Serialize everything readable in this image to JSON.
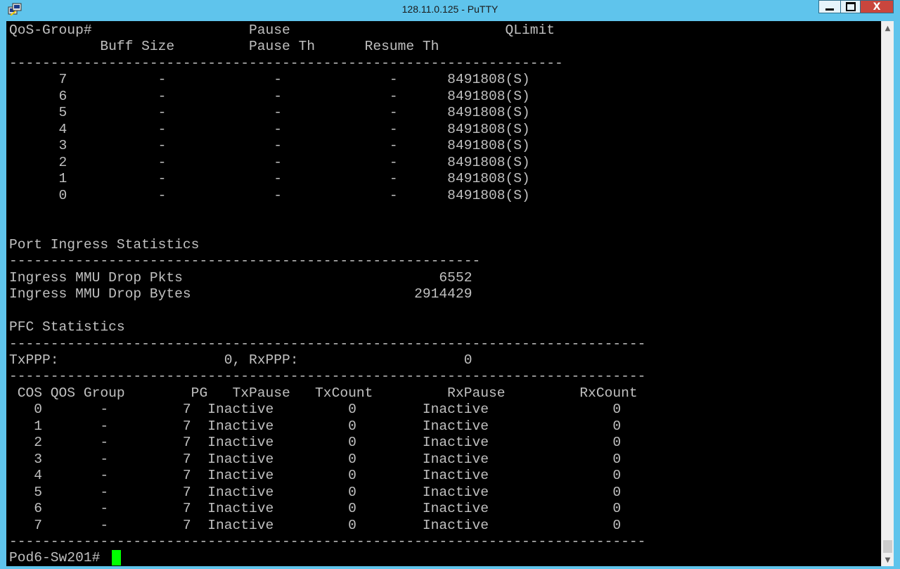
{
  "window": {
    "title": "128.11.0.125 - PuTTY",
    "icon": "putty-icon",
    "minimize_icon": "minimize-icon",
    "maximize_icon": "maximize-icon",
    "close_label": "X"
  },
  "terminal": {
    "lines": [
      "QoS-Group#                   Pause                          QLimit",
      "           Buff Size         Pause Th      Resume Th",
      "-------------------------------------------------------------------",
      "      7           -             -             -      8491808(S)",
      "      6           -             -             -      8491808(S)",
      "      5           -             -             -      8491808(S)",
      "      4           -             -             -      8491808(S)",
      "      3           -             -             -      8491808(S)",
      "      2           -             -             -      8491808(S)",
      "      1           -             -             -      8491808(S)",
      "      0           -             -             -      8491808(S)",
      "",
      "",
      "Port Ingress Statistics",
      "---------------------------------------------------------",
      "Ingress MMU Drop Pkts                               6552",
      "Ingress MMU Drop Bytes                           2914429",
      "",
      "PFC Statistics",
      "-----------------------------------------------------------------------------",
      "TxPPP:                    0, RxPPP:                    0",
      "-----------------------------------------------------------------------------",
      " COS QOS Group        PG   TxPause   TxCount         RxPause         RxCount",
      "   0       -         7  Inactive         0        Inactive               0",
      "   1       -         7  Inactive         0        Inactive               0",
      "   2       -         7  Inactive         0        Inactive               0",
      "   3       -         7  Inactive         0        Inactive               0",
      "   4       -         7  Inactive         0        Inactive               0",
      "   5       -         7  Inactive         0        Inactive               0",
      "   6       -         7  Inactive         0        Inactive               0",
      "   7       -         7  Inactive         0        Inactive               0",
      "-----------------------------------------------------------------------------",
      "Pod6-Sw201# "
    ],
    "cursor_color": "#00ff00",
    "background": "#000000",
    "foreground": "#c0c0c0"
  },
  "scrollbar": {
    "up_icon": "scroll-up-arrow-icon",
    "down_icon": "scroll-down-arrow-icon"
  },
  "colors": {
    "title_bar": "#5fc4ec",
    "close_button": "#c9463d"
  }
}
